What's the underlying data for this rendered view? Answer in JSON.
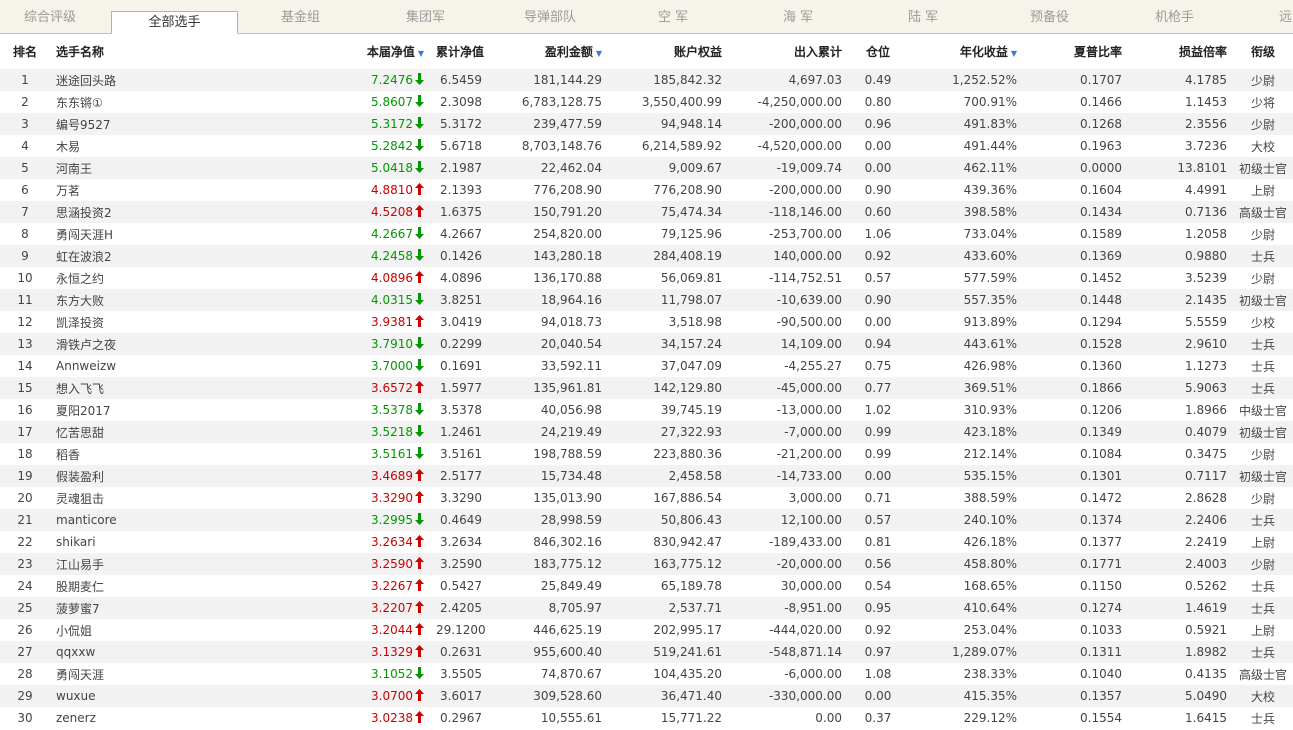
{
  "tabs": [
    "综合评级",
    "全部选手",
    "基金组",
    "集团军",
    "导弹部队",
    "空 军",
    "海 军",
    "陆 军",
    "预备役",
    "机枪手",
    "远"
  ],
  "active_tab": 1,
  "headers": {
    "rank": "排名",
    "name": "选手名称",
    "nav": "本届净值",
    "cumnav": "累计净值",
    "profit": "盈利金额",
    "equity": "账户权益",
    "inout": "出入累计",
    "position": "仓位",
    "annual": "年化收益",
    "sharpe": "夏普比率",
    "pl": "损益倍率",
    "title": "衔级"
  },
  "sorted_columns": [
    "nav",
    "profit",
    "annual"
  ],
  "colors": {
    "up": "#cc0000",
    "down": "#009900",
    "sort": "#3a7ad8"
  },
  "rows": [
    {
      "rank": "1",
      "name": "迷途回头路",
      "nav": "7.2476",
      "dir": "down",
      "cumnav": "6.5459",
      "profit": "181,144.29",
      "equity": "185,842.32",
      "inout": "4,697.03",
      "position": "0.49",
      "annual": "1,252.52%",
      "sharpe": "0.1707",
      "pl": "4.1785",
      "title": "少尉"
    },
    {
      "rank": "2",
      "name": "东东锵①",
      "nav": "5.8607",
      "dir": "down",
      "cumnav": "2.3098",
      "profit": "6,783,128.75",
      "equity": "3,550,400.99",
      "inout": "-4,250,000.00",
      "position": "0.80",
      "annual": "700.91%",
      "sharpe": "0.1466",
      "pl": "1.1453",
      "title": "少将"
    },
    {
      "rank": "3",
      "name": "编号9527",
      "nav": "5.3172",
      "dir": "down",
      "cumnav": "5.3172",
      "profit": "239,477.59",
      "equity": "94,948.14",
      "inout": "-200,000.00",
      "position": "0.96",
      "annual": "491.83%",
      "sharpe": "0.1268",
      "pl": "2.3556",
      "title": "少尉"
    },
    {
      "rank": "4",
      "name": "木易",
      "nav": "5.2842",
      "dir": "down",
      "cumnav": "5.6718",
      "profit": "8,703,148.76",
      "equity": "6,214,589.92",
      "inout": "-4,520,000.00",
      "position": "0.00",
      "annual": "491.44%",
      "sharpe": "0.1963",
      "pl": "3.7236",
      "title": "大校"
    },
    {
      "rank": "5",
      "name": "河南王",
      "nav": "5.0418",
      "dir": "down",
      "cumnav": "2.1987",
      "profit": "22,462.04",
      "equity": "9,009.67",
      "inout": "-19,009.74",
      "position": "0.00",
      "annual": "462.11%",
      "sharpe": "0.0000",
      "pl": "13.8101",
      "title": "初级士官"
    },
    {
      "rank": "6",
      "name": "万茗",
      "nav": "4.8810",
      "dir": "up",
      "cumnav": "2.1393",
      "profit": "776,208.90",
      "equity": "776,208.90",
      "inout": "-200,000.00",
      "position": "0.90",
      "annual": "439.36%",
      "sharpe": "0.1604",
      "pl": "4.4991",
      "title": "上尉"
    },
    {
      "rank": "7",
      "name": "思涵投资2",
      "nav": "4.5208",
      "dir": "up",
      "cumnav": "1.6375",
      "profit": "150,791.20",
      "equity": "75,474.34",
      "inout": "-118,146.00",
      "position": "0.60",
      "annual": "398.58%",
      "sharpe": "0.1434",
      "pl": "0.7136",
      "title": "高级士官"
    },
    {
      "rank": "8",
      "name": "勇闯天涯H",
      "nav": "4.2667",
      "dir": "down",
      "cumnav": "4.2667",
      "profit": "254,820.00",
      "equity": "79,125.96",
      "inout": "-253,700.00",
      "position": "1.06",
      "annual": "733.04%",
      "sharpe": "0.1589",
      "pl": "1.2058",
      "title": "少尉"
    },
    {
      "rank": "9",
      "name": "虹在波浪2",
      "nav": "4.2458",
      "dir": "down",
      "cumnav": "0.1426",
      "profit": "143,280.18",
      "equity": "284,408.19",
      "inout": "140,000.00",
      "position": "0.92",
      "annual": "433.60%",
      "sharpe": "0.1369",
      "pl": "0.9880",
      "title": "士兵"
    },
    {
      "rank": "10",
      "name": "永恒之约",
      "nav": "4.0896",
      "dir": "up",
      "cumnav": "4.0896",
      "profit": "136,170.88",
      "equity": "56,069.81",
      "inout": "-114,752.51",
      "position": "0.57",
      "annual": "577.59%",
      "sharpe": "0.1452",
      "pl": "3.5239",
      "title": "少尉"
    },
    {
      "rank": "11",
      "name": "东方大败",
      "nav": "4.0315",
      "dir": "down",
      "cumnav": "3.8251",
      "profit": "18,964.16",
      "equity": "11,798.07",
      "inout": "-10,639.00",
      "position": "0.90",
      "annual": "557.35%",
      "sharpe": "0.1448",
      "pl": "2.1435",
      "title": "初级士官"
    },
    {
      "rank": "12",
      "name": "凯泽投资",
      "nav": "3.9381",
      "dir": "up",
      "cumnav": "3.0419",
      "profit": "94,018.73",
      "equity": "3,518.98",
      "inout": "-90,500.00",
      "position": "0.00",
      "annual": "913.89%",
      "sharpe": "0.1294",
      "pl": "5.5559",
      "title": "少校"
    },
    {
      "rank": "13",
      "name": "滑铁卢之夜",
      "nav": "3.7910",
      "dir": "down",
      "cumnav": "0.2299",
      "profit": "20,040.54",
      "equity": "34,157.24",
      "inout": "14,109.00",
      "position": "0.94",
      "annual": "443.61%",
      "sharpe": "0.1528",
      "pl": "2.9610",
      "title": "士兵"
    },
    {
      "rank": "14",
      "name": "Annweizw",
      "nav": "3.7000",
      "dir": "down",
      "cumnav": "0.1691",
      "profit": "33,592.11",
      "equity": "37,047.09",
      "inout": "-4,255.27",
      "position": "0.75",
      "annual": "426.98%",
      "sharpe": "0.1360",
      "pl": "1.1273",
      "title": "士兵"
    },
    {
      "rank": "15",
      "name": "想入飞飞",
      "nav": "3.6572",
      "dir": "up",
      "cumnav": "1.5977",
      "profit": "135,961.81",
      "equity": "142,129.80",
      "inout": "-45,000.00",
      "position": "0.77",
      "annual": "369.51%",
      "sharpe": "0.1866",
      "pl": "5.9063",
      "title": "士兵"
    },
    {
      "rank": "16",
      "name": "夏阳2017",
      "nav": "3.5378",
      "dir": "down",
      "cumnav": "3.5378",
      "profit": "40,056.98",
      "equity": "39,745.19",
      "inout": "-13,000.00",
      "position": "1.02",
      "annual": "310.93%",
      "sharpe": "0.1206",
      "pl": "1.8966",
      "title": "中级士官"
    },
    {
      "rank": "17",
      "name": "忆苦思甜",
      "nav": "3.5218",
      "dir": "down",
      "cumnav": "1.2461",
      "profit": "24,219.49",
      "equity": "27,322.93",
      "inout": "-7,000.00",
      "position": "0.99",
      "annual": "423.18%",
      "sharpe": "0.1349",
      "pl": "0.4079",
      "title": "初级士官"
    },
    {
      "rank": "18",
      "name": "稻香",
      "nav": "3.5161",
      "dir": "down",
      "cumnav": "3.5161",
      "profit": "198,788.59",
      "equity": "223,880.36",
      "inout": "-21,200.00",
      "position": "0.99",
      "annual": "212.14%",
      "sharpe": "0.1084",
      "pl": "0.3475",
      "title": "少尉"
    },
    {
      "rank": "19",
      "name": "假装盈利",
      "nav": "3.4689",
      "dir": "up",
      "cumnav": "2.5177",
      "profit": "15,734.48",
      "equity": "2,458.58",
      "inout": "-14,733.00",
      "position": "0.00",
      "annual": "535.15%",
      "sharpe": "0.1301",
      "pl": "0.7117",
      "title": "初级士官"
    },
    {
      "rank": "20",
      "name": "灵魂狙击",
      "nav": "3.3290",
      "dir": "up",
      "cumnav": "3.3290",
      "profit": "135,013.90",
      "equity": "167,886.54",
      "inout": "3,000.00",
      "position": "0.71",
      "annual": "388.59%",
      "sharpe": "0.1472",
      "pl": "2.8628",
      "title": "少尉"
    },
    {
      "rank": "21",
      "name": "manticore",
      "nav": "3.2995",
      "dir": "down",
      "cumnav": "0.4649",
      "profit": "28,998.59",
      "equity": "50,806.43",
      "inout": "12,100.00",
      "position": "0.57",
      "annual": "240.10%",
      "sharpe": "0.1374",
      "pl": "2.2406",
      "title": "士兵"
    },
    {
      "rank": "22",
      "name": "shikari",
      "nav": "3.2634",
      "dir": "up",
      "cumnav": "3.2634",
      "profit": "846,302.16",
      "equity": "830,942.47",
      "inout": "-189,433.00",
      "position": "0.81",
      "annual": "426.18%",
      "sharpe": "0.1377",
      "pl": "2.2419",
      "title": "上尉"
    },
    {
      "rank": "23",
      "name": "江山易手",
      "nav": "3.2590",
      "dir": "up",
      "cumnav": "3.2590",
      "profit": "183,775.12",
      "equity": "163,775.12",
      "inout": "-20,000.00",
      "position": "0.56",
      "annual": "458.80%",
      "sharpe": "0.1771",
      "pl": "2.4003",
      "title": "少尉"
    },
    {
      "rank": "24",
      "name": "股期麦仁",
      "nav": "3.2267",
      "dir": "up",
      "cumnav": "0.5427",
      "profit": "25,849.49",
      "equity": "65,189.78",
      "inout": "30,000.00",
      "position": "0.54",
      "annual": "168.65%",
      "sharpe": "0.1150",
      "pl": "0.5262",
      "title": "士兵"
    },
    {
      "rank": "25",
      "name": "菠萝蜜7",
      "nav": "3.2207",
      "dir": "up",
      "cumnav": "2.4205",
      "profit": "8,705.97",
      "equity": "2,537.71",
      "inout": "-8,951.00",
      "position": "0.95",
      "annual": "410.64%",
      "sharpe": "0.1274",
      "pl": "1.4619",
      "title": "士兵"
    },
    {
      "rank": "26",
      "name": "小侃姐",
      "nav": "3.2044",
      "dir": "up",
      "cumnav": "29.1200",
      "profit": "446,625.19",
      "equity": "202,995.17",
      "inout": "-444,020.00",
      "position": "0.92",
      "annual": "253.04%",
      "sharpe": "0.1033",
      "pl": "0.5921",
      "title": "上尉"
    },
    {
      "rank": "27",
      "name": "qqxxw",
      "nav": "3.1329",
      "dir": "up",
      "cumnav": "0.2631",
      "profit": "955,600.40",
      "equity": "519,241.61",
      "inout": "-548,871.14",
      "position": "0.97",
      "annual": "1,289.07%",
      "sharpe": "0.1311",
      "pl": "1.8982",
      "title": "士兵"
    },
    {
      "rank": "28",
      "name": "勇闯天涯",
      "nav": "3.1052",
      "dir": "down",
      "cumnav": "3.5505",
      "profit": "74,870.67",
      "equity": "104,435.20",
      "inout": "-6,000.00",
      "position": "1.08",
      "annual": "238.33%",
      "sharpe": "0.1040",
      "pl": "0.4135",
      "title": "高级士官"
    },
    {
      "rank": "29",
      "name": "wuxue",
      "nav": "3.0700",
      "dir": "up",
      "cumnav": "3.6017",
      "profit": "309,528.60",
      "equity": "36,471.40",
      "inout": "-330,000.00",
      "position": "0.00",
      "annual": "415.35%",
      "sharpe": "0.1357",
      "pl": "5.0490",
      "title": "大校"
    },
    {
      "rank": "30",
      "name": "zenerz",
      "nav": "3.0238",
      "dir": "up",
      "cumnav": "0.2967",
      "profit": "10,555.61",
      "equity": "15,771.22",
      "inout": "0.00",
      "position": "0.37",
      "annual": "229.12%",
      "sharpe": "0.1554",
      "pl": "1.6415",
      "title": "士兵"
    }
  ]
}
